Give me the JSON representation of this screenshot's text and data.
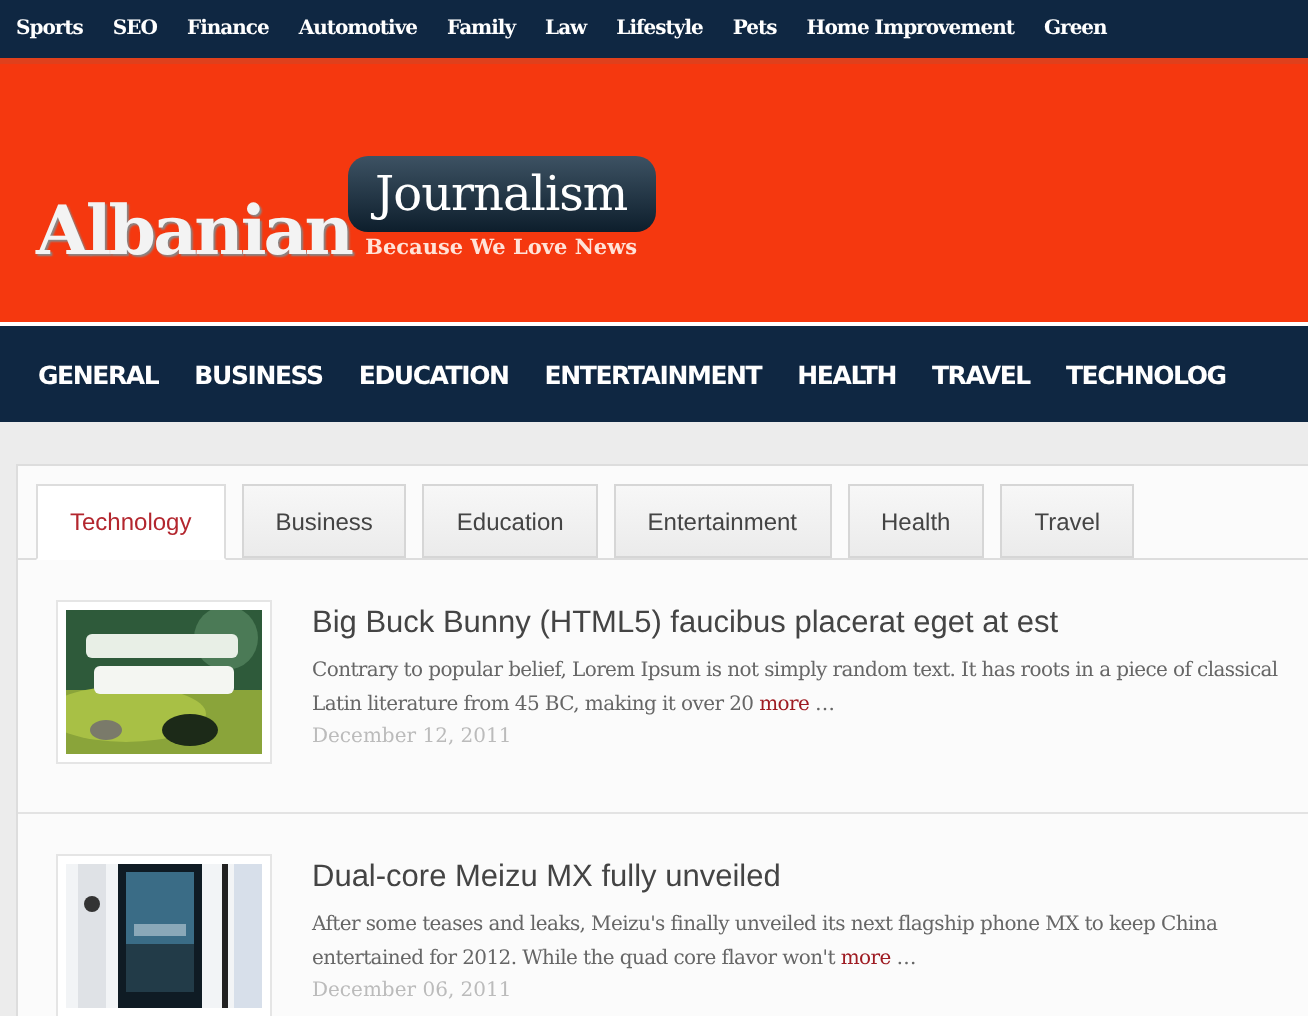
{
  "top_bar": {
    "links": [
      "Sports",
      "SEO",
      "Finance",
      "Automotive",
      "Family",
      "Law",
      "Lifestyle",
      "Pets",
      "Home Improvement",
      "Green"
    ]
  },
  "logo": {
    "word": "Albanian",
    "bubble": "Journalism",
    "tagline": "Because We Love News"
  },
  "main_nav": {
    "items": [
      "GENERAL",
      "BUSINESS",
      "EDUCATION",
      "ENTERTAINMENT",
      "HEALTH",
      "TRAVEL",
      "TECHNOLOG"
    ]
  },
  "tabs": [
    {
      "label": "Technology",
      "selected": true
    },
    {
      "label": "Business",
      "selected": false
    },
    {
      "label": "Education",
      "selected": false
    },
    {
      "label": "Entertainment",
      "selected": false
    },
    {
      "label": "Health",
      "selected": false
    },
    {
      "label": "Travel",
      "selected": false
    }
  ],
  "articles": [
    {
      "title": "Big Buck Bunny (HTML5) faucibus placerat eget at est",
      "excerpt": "Contrary to popular belief, Lorem Ipsum is not simply random text. It has roots in a piece of classical Latin literature from 45 BC, making it over 20",
      "more": "more",
      "ellipsis": "…",
      "date": "December 12, 2011"
    },
    {
      "title": "Dual-core Meizu MX fully unveiled",
      "excerpt": "After some teases and leaks, Meizu's finally unveiled its next flagship phone MX to keep China entertained for 2012. While the quad core flavor won't",
      "more": "more",
      "ellipsis": "…",
      "date": "December 06, 2011"
    }
  ]
}
